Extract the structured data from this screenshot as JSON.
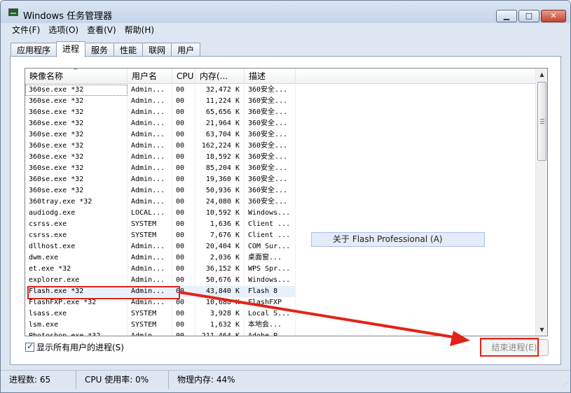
{
  "window": {
    "title": "Windows 任务管理器"
  },
  "window_controls": {
    "minimize": "▁",
    "maximize": "□",
    "close": "✕"
  },
  "menu": [
    "文件(F)",
    "选项(O)",
    "查看(V)",
    "帮助(H)"
  ],
  "tabs": [
    {
      "label": "应用程序",
      "active": false
    },
    {
      "label": "进程",
      "active": true
    },
    {
      "label": "服务",
      "active": false
    },
    {
      "label": "性能",
      "active": false
    },
    {
      "label": "联网",
      "active": false
    },
    {
      "label": "用户",
      "active": false
    }
  ],
  "columns": [
    "映像名称",
    "用户名",
    "CPU",
    "内存(...",
    "描述"
  ],
  "sort_indicator": "^",
  "processes": [
    {
      "name": "360se.exe *32",
      "user": "Admin...",
      "cpu": "00",
      "mem": "32,472 K",
      "desc": "360安全..."
    },
    {
      "name": "360se.exe *32",
      "user": "Admin...",
      "cpu": "00",
      "mem": "11,224 K",
      "desc": "360安全..."
    },
    {
      "name": "360se.exe *32",
      "user": "Admin...",
      "cpu": "00",
      "mem": "65,656 K",
      "desc": "360安全..."
    },
    {
      "name": "360se.exe *32",
      "user": "Admin...",
      "cpu": "00",
      "mem": "21,964 K",
      "desc": "360安全..."
    },
    {
      "name": "360se.exe *32",
      "user": "Admin...",
      "cpu": "00",
      "mem": "63,704 K",
      "desc": "360安全..."
    },
    {
      "name": "360se.exe *32",
      "user": "Admin...",
      "cpu": "00",
      "mem": "162,224 K",
      "desc": "360安全..."
    },
    {
      "name": "360se.exe *32",
      "user": "Admin...",
      "cpu": "00",
      "mem": "18,592 K",
      "desc": "360安全..."
    },
    {
      "name": "360se.exe *32",
      "user": "Admin...",
      "cpu": "00",
      "mem": "85,204 K",
      "desc": "360安全..."
    },
    {
      "name": "360se.exe *32",
      "user": "Admin...",
      "cpu": "00",
      "mem": "19,360 K",
      "desc": "360安全..."
    },
    {
      "name": "360se.exe *32",
      "user": "Admin...",
      "cpu": "00",
      "mem": "50,936 K",
      "desc": "360安全..."
    },
    {
      "name": "360tray.exe *32",
      "user": "Admin...",
      "cpu": "00",
      "mem": "24,080 K",
      "desc": "360安全..."
    },
    {
      "name": "audiodg.exe",
      "user": "LOCAL...",
      "cpu": "00",
      "mem": "10,592 K",
      "desc": "Windows..."
    },
    {
      "name": "csrss.exe",
      "user": "SYSTEM",
      "cpu": "00",
      "mem": "1,636 K",
      "desc": "Client ..."
    },
    {
      "name": "csrss.exe",
      "user": "SYSTEM",
      "cpu": "00",
      "mem": "7,676 K",
      "desc": "Client ..."
    },
    {
      "name": "dllhost.exe",
      "user": "Admin...",
      "cpu": "00",
      "mem": "20,404 K",
      "desc": "COM Sur..."
    },
    {
      "name": "dwm.exe",
      "user": "Admin...",
      "cpu": "00",
      "mem": "2,036 K",
      "desc": "桌面窗..."
    },
    {
      "name": "et.exe *32",
      "user": "Admin...",
      "cpu": "00",
      "mem": "36,152 K",
      "desc": "WPS Spr..."
    },
    {
      "name": "explorer.exe",
      "user": "Admin...",
      "cpu": "00",
      "mem": "50,676 K",
      "desc": "Windows..."
    },
    {
      "name": "Flash.exe *32",
      "user": "Admin...",
      "cpu": "00",
      "mem": "43,840 K",
      "desc": "Flash 8"
    },
    {
      "name": "FlashFXP.exe *32",
      "user": "Admin...",
      "cpu": "00",
      "mem": "10,688 K",
      "desc": "FlashFXP"
    },
    {
      "name": "lsass.exe",
      "user": "SYSTEM",
      "cpu": "00",
      "mem": "3,928 K",
      "desc": "Local S..."
    },
    {
      "name": "lsm.exe",
      "user": "SYSTEM",
      "cpu": "00",
      "mem": "1,632 K",
      "desc": "本地会..."
    },
    {
      "name": "Photoshop.exe *32",
      "user": "Admin...",
      "cpu": "00",
      "mem": "211,464 K",
      "desc": "Adobe P..."
    }
  ],
  "scroll_arrows": {
    "up": "▲",
    "down": "▼"
  },
  "context_item": "关于 Flash Professional (A)",
  "show_all_users": {
    "checked": true,
    "label": "显示所有用户的进程(S)",
    "tick": "✓"
  },
  "end_process_button": "结束进程(E)",
  "status": {
    "processes": "进程数: 65",
    "cpu": "CPU 使用率: 0%",
    "memory": "物理内存: 44%"
  },
  "resize_grip": "⋰",
  "annotation_color": "#e2231a"
}
